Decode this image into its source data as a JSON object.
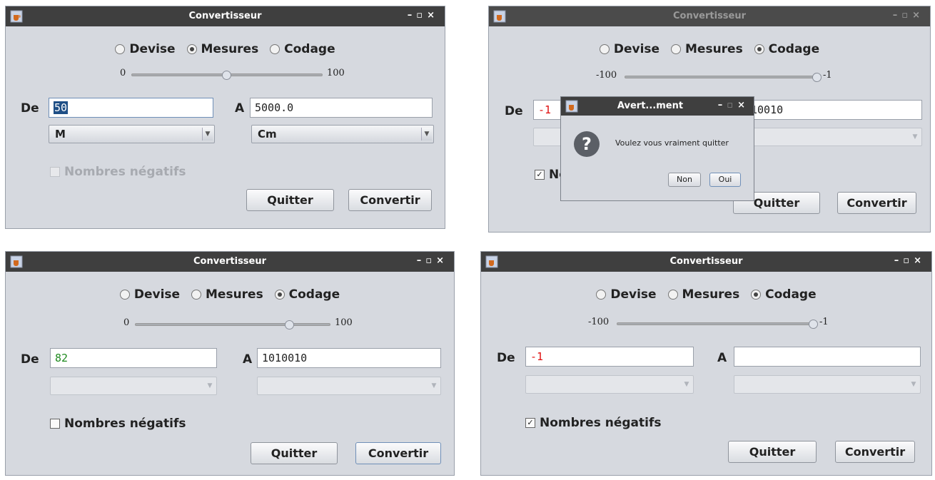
{
  "java_icon": "java-cup-icon",
  "window_controls": {
    "minimize": "–",
    "maximize": "▫",
    "close": "×"
  },
  "windows": [
    {
      "title": "Convertisseur",
      "radios": [
        "Devise",
        "Mesures",
        "Codage"
      ],
      "selected_radio": "Mesures",
      "slider": {
        "min": "0",
        "max": "100",
        "value_fraction": 0.5
      },
      "de_label": "De",
      "a_label": "A",
      "de_value": "50",
      "a_value": "5000.0",
      "combo_from": "M",
      "combo_to": "Cm",
      "check_label": "Nombres négatifs",
      "check_checked": false,
      "check_enabled": false,
      "quit_label": "Quitter",
      "convert_label": "Convertir"
    },
    {
      "title": "Convertisseur",
      "radios": [
        "Devise",
        "Mesures",
        "Codage"
      ],
      "selected_radio": "Codage",
      "slider": {
        "min": "-100",
        "max": "-1",
        "value_fraction": 1.0
      },
      "de_label": "De",
      "de_value": "-1",
      "a_value_visible": "10010",
      "check_label_visible": "No",
      "check_checked": true,
      "quit_label": "Quitter",
      "convert_label": "Convertir",
      "dialog": {
        "title": "Avert...ment",
        "message": "Voulez vous vraiment quitter",
        "no_label": "Non",
        "yes_label": "Oui",
        "icon": "question-icon"
      }
    },
    {
      "title": "Convertisseur",
      "radios": [
        "Devise",
        "Mesures",
        "Codage"
      ],
      "selected_radio": "Codage",
      "slider": {
        "min": "0",
        "max": "100",
        "value_fraction": 0.82
      },
      "de_label": "De",
      "a_label": "A",
      "de_value": "82",
      "de_value_color": "#1f8a1f",
      "a_value": "1010010",
      "check_label": "Nombres négatifs",
      "check_checked": false,
      "quit_label": "Quitter",
      "convert_label": "Convertir"
    },
    {
      "title": "Convertisseur",
      "radios": [
        "Devise",
        "Mesures",
        "Codage"
      ],
      "selected_radio": "Codage",
      "slider": {
        "min": "-100",
        "max": "-1",
        "value_fraction": 1.0
      },
      "de_label": "De",
      "a_label": "A",
      "de_value": "-1",
      "de_value_color": "#e01010",
      "a_value": "",
      "check_label": "Nombres négatifs",
      "check_checked": true,
      "quit_label": "Quitter",
      "convert_label": "Convertir"
    }
  ]
}
